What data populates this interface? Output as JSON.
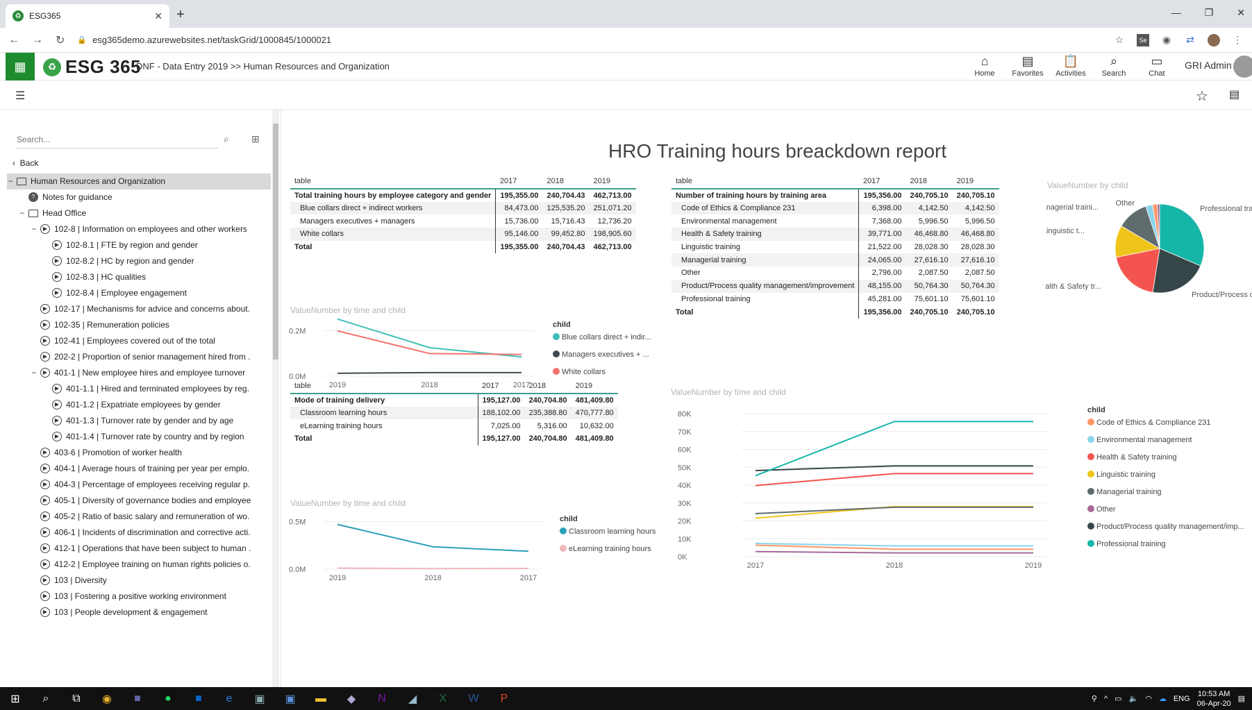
{
  "browser": {
    "tab_title": "ESG365",
    "url": "esg365demo.azurewebsites.net/taskGrid/1000845/1000021"
  },
  "app": {
    "logo_text": "ESG 365",
    "breadcrumb": "DNF - Data Entry 2019 >> Human Resources and Organization",
    "nav": [
      {
        "label": "Home",
        "icon": "home-icon"
      },
      {
        "label": "Favorites",
        "icon": "favorites-icon"
      },
      {
        "label": "Activities",
        "icon": "activities-icon"
      },
      {
        "label": "Search",
        "icon": "search-icon"
      },
      {
        "label": "Chat",
        "icon": "chat-icon"
      }
    ],
    "user": "GRI Admin"
  },
  "sidebar": {
    "search_placeholder": "Search...",
    "back_label": "Back",
    "tree": [
      {
        "label": "Human Resources and Organization",
        "level": 0,
        "type": "folder",
        "expander": "−",
        "selected": true
      },
      {
        "label": "Notes for guidance",
        "level": 1,
        "type": "help",
        "expander": ""
      },
      {
        "label": "Head Office",
        "level": 1,
        "type": "folder",
        "expander": "−"
      },
      {
        "label": "102-8 | Information on employees and other workers",
        "level": 2,
        "type": "play",
        "expander": "−"
      },
      {
        "label": "102-8.1 | FTE by region and gender",
        "level": 3,
        "type": "play",
        "expander": ""
      },
      {
        "label": "102-8.2 | HC by region and gender",
        "level": 3,
        "type": "play",
        "expander": ""
      },
      {
        "label": "102-8.3 | HC qualities",
        "level": 3,
        "type": "play",
        "expander": ""
      },
      {
        "label": "102-8.4 | Employee engagement",
        "level": 3,
        "type": "play",
        "expander": ""
      },
      {
        "label": "102-17 | Mechanisms for advice and concerns about.",
        "level": 2,
        "type": "play",
        "expander": ""
      },
      {
        "label": "102-35 | Remuneration policies",
        "level": 2,
        "type": "play",
        "expander": ""
      },
      {
        "label": "102-41 | Employees covered out of the total",
        "level": 2,
        "type": "play",
        "expander": ""
      },
      {
        "label": "202-2 | Proportion of senior management hired from .",
        "level": 2,
        "type": "play",
        "expander": ""
      },
      {
        "label": "401-1 | New employee hires and employee turnover",
        "level": 2,
        "type": "play",
        "expander": "−"
      },
      {
        "label": "401-1.1 | Hired and terminated employees by reg.",
        "level": 3,
        "type": "play",
        "expander": ""
      },
      {
        "label": "401-1.2 | Expatriate employees by gender",
        "level": 3,
        "type": "play",
        "expander": ""
      },
      {
        "label": "401-1.3 | Turnover rate by gender and by age",
        "level": 3,
        "type": "play",
        "expander": ""
      },
      {
        "label": "401-1.4 | Turnover rate by country and by region",
        "level": 3,
        "type": "play",
        "expander": ""
      },
      {
        "label": "403-6 | Promotion of worker health",
        "level": 2,
        "type": "play",
        "expander": ""
      },
      {
        "label": "404-1 | Average hours of training per year per emplo.",
        "level": 2,
        "type": "play",
        "expander": ""
      },
      {
        "label": "404-3 | Percentage of employees receiving regular p.",
        "level": 2,
        "type": "play",
        "expander": ""
      },
      {
        "label": "405-1 | Diversity of governance bodies and employee",
        "level": 2,
        "type": "play",
        "expander": ""
      },
      {
        "label": "405-2 | Ratio of basic salary and remuneration of wo.",
        "level": 2,
        "type": "play",
        "expander": ""
      },
      {
        "label": "406-1 | Incidents of discrimination and corrective acti.",
        "level": 2,
        "type": "play",
        "expander": ""
      },
      {
        "label": "412-1 | Operations that have been subject to human .",
        "level": 2,
        "type": "play",
        "expander": ""
      },
      {
        "label": "412-2 | Employee training on human rights policies o.",
        "level": 2,
        "type": "play",
        "expander": ""
      },
      {
        "label": "103 | Diversity",
        "level": 2,
        "type": "play",
        "expander": ""
      },
      {
        "label": "103 | Fostering a positive working environment",
        "level": 2,
        "type": "play",
        "expander": ""
      },
      {
        "label": "103 | People development & engagement",
        "level": 2,
        "type": "play",
        "expander": ""
      }
    ]
  },
  "report": {
    "title": "HRO Training hours breackdown report",
    "table1": {
      "headers": [
        "table",
        "2017",
        "2018",
        "2019"
      ],
      "rows": [
        [
          "Total training hours by employee category and gender",
          "195,355.00",
          "240,704.43",
          "462,713.00"
        ],
        [
          "Blue collars direct + indirect workers",
          "84,473.00",
          "125,535.20",
          "251,071.20"
        ],
        [
          "Managers executives + managers",
          "15,736.00",
          "15,716.43",
          "12,736.20"
        ],
        [
          "White collars",
          "95,146.00",
          "99,452.80",
          "198,905.60"
        ],
        [
          "Total",
          "195,355.00",
          "240,704.43",
          "462,713.00"
        ]
      ]
    },
    "table2": {
      "headers": [
        "table",
        "2017",
        "2018",
        "2019"
      ],
      "rows": [
        [
          "Number of training hours by training area",
          "195,356.00",
          "240,705.10",
          "240,705.10"
        ],
        [
          "Code of Ethics & Compliance 231",
          "6,398.00",
          "4,142.50",
          "4,142.50"
        ],
        [
          "Environmental management",
          "7,368.00",
          "5,996.50",
          "5,996.50"
        ],
        [
          "Health & Safety training",
          "39,771.00",
          "46,468.80",
          "46,468.80"
        ],
        [
          "Linguistic training",
          "21,522.00",
          "28,028.30",
          "28,028.30"
        ],
        [
          "Managerial training",
          "24,065.00",
          "27,616.10",
          "27,616.10"
        ],
        [
          "Other",
          "2,796.00",
          "2,087.50",
          "2,087.50"
        ],
        [
          "Product/Process quality management/improvement",
          "48,155.00",
          "50,764.30",
          "50,764.30"
        ],
        [
          "Professional training",
          "45,281.00",
          "75,601.10",
          "75,601.10"
        ],
        [
          "Total",
          "195,356.00",
          "240,705.10",
          "240,705.10"
        ]
      ]
    },
    "table3": {
      "headers": [
        "table",
        "2017",
        "2018",
        "2019"
      ],
      "rows": [
        [
          "Mode of training delivery",
          "195,127.00",
          "240,704.80",
          "481,409.80"
        ],
        [
          "Classroom learning hours",
          "188,102.00",
          "235,388.80",
          "470,777.80"
        ],
        [
          "eLearning training hours",
          "7,025.00",
          "5,316.00",
          "10,632.00"
        ],
        [
          "Total",
          "195,127.00",
          "240,704.80",
          "481,409.80"
        ]
      ]
    }
  },
  "chart_data": [
    {
      "type": "line",
      "title": "ValueNumber by time and child",
      "categories": [
        "2019",
        "2018",
        "2017"
      ],
      "ylim": [
        0,
        0.25
      ],
      "y_ticks": [
        "0.0M",
        "0.2M"
      ],
      "y_tick_values": [
        0,
        0.2
      ],
      "legend_title": "child",
      "series": [
        {
          "name": "Blue collars direct + indir...",
          "color": "#3cc0b8",
          "values": [
            0.251,
            0.1255,
            0.0845
          ]
        },
        {
          "name": "Managers executives + ...",
          "color": "#3f4b4f",
          "values": [
            0.0127,
            0.0157,
            0.0157
          ]
        },
        {
          "name": "White collars",
          "color": "#f4726d",
          "values": [
            0.1989,
            0.0995,
            0.0951
          ]
        }
      ]
    },
    {
      "type": "line",
      "title": "ValueNumber by time and child",
      "categories": [
        "2019",
        "2018",
        "2017"
      ],
      "ylim": [
        0,
        0.6
      ],
      "y_ticks": [
        "0.0M",
        "0.5M"
      ],
      "y_tick_values": [
        0,
        0.5
      ],
      "legend_title": "child",
      "series": [
        {
          "name": "Classroom learning hours",
          "color": "#2e9fb8",
          "values": [
            0.4708,
            0.2354,
            0.1881
          ]
        },
        {
          "name": "eLearning training hours",
          "color": "#f0b8bd",
          "values": [
            0.0106,
            0.0053,
            0.007
          ]
        }
      ]
    },
    {
      "type": "pie",
      "title": "ValueNumber by child",
      "slice_labels": [
        "Professional trai",
        "Product/Process qua",
        "Health & Safety tr...",
        "Linguistic t...",
        "Managerial traini...",
        "Other"
      ],
      "slices": [
        {
          "name": "Professional training",
          "color": "#15b6a8",
          "value": 75601.1
        },
        {
          "name": "Product/Process quality management/imp...",
          "color": "#374649",
          "value": 50764.3
        },
        {
          "name": "Health & Safety training",
          "color": "#f4544f",
          "value": 46468.8
        },
        {
          "name": "Linguistic training",
          "color": "#f0c51b",
          "value": 28028.3
        },
        {
          "name": "Managerial training",
          "color": "#5f6b6d",
          "value": 27616.1
        },
        {
          "name": "Environmental management",
          "color": "#8ad4eb",
          "value": 5996.5
        },
        {
          "name": "Code of Ethics & Compliance 231",
          "color": "#fe9666",
          "value": 4142.5
        },
        {
          "name": "Other",
          "color": "#a66999",
          "value": 2087.5
        }
      ]
    },
    {
      "type": "line",
      "title": "ValueNumber by time and child",
      "categories": [
        "2017",
        "2018",
        "2019"
      ],
      "ylim": [
        0,
        80000
      ],
      "y_ticks": [
        "0K",
        "10K",
        "20K",
        "30K",
        "40K",
        "50K",
        "60K",
        "70K",
        "80K"
      ],
      "y_tick_values": [
        0,
        10000,
        20000,
        30000,
        40000,
        50000,
        60000,
        70000,
        80000
      ],
      "legend_title": "child",
      "series": [
        {
          "name": "Code of Ethics & Compliance 231",
          "color": "#fe9666",
          "values": [
            6398,
            4142.5,
            4142.5
          ]
        },
        {
          "name": "Environmental management",
          "color": "#8ad4eb",
          "values": [
            7368,
            5996.5,
            5996.5
          ]
        },
        {
          "name": "Health & Safety training",
          "color": "#f4544f",
          "values": [
            39771,
            46468.8,
            46468.8
          ]
        },
        {
          "name": "Linguistic training",
          "color": "#f0c51b",
          "values": [
            21522,
            28028.3,
            28028.3
          ]
        },
        {
          "name": "Managerial training",
          "color": "#5f6b6d",
          "values": [
            24065,
            27616.1,
            27616.1
          ]
        },
        {
          "name": "Other",
          "color": "#a66999",
          "values": [
            2796,
            2087.5,
            2087.5
          ]
        },
        {
          "name": "Product/Process quality management/imp...",
          "color": "#374649",
          "values": [
            48155,
            50764.3,
            50764.3
          ]
        },
        {
          "name": "Professional training",
          "color": "#15b6a8",
          "values": [
            45281,
            75601.1,
            75601.1
          ]
        }
      ]
    }
  ],
  "taskbar": {
    "time": "10:53 AM",
    "date": "06-Apr-20",
    "lang": "ENG"
  }
}
